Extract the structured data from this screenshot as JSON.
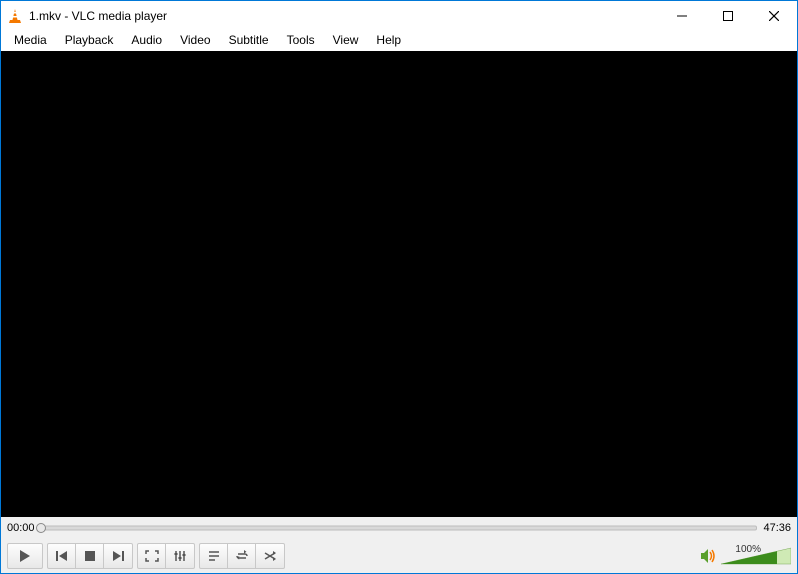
{
  "titlebar": {
    "title": "1.mkv - VLC media player"
  },
  "menu": {
    "items": [
      "Media",
      "Playback",
      "Audio",
      "Video",
      "Subtitle",
      "Tools",
      "View",
      "Help"
    ]
  },
  "playback": {
    "elapsed": "00:00",
    "total": "47:36"
  },
  "volume": {
    "percent_label": "100%"
  }
}
